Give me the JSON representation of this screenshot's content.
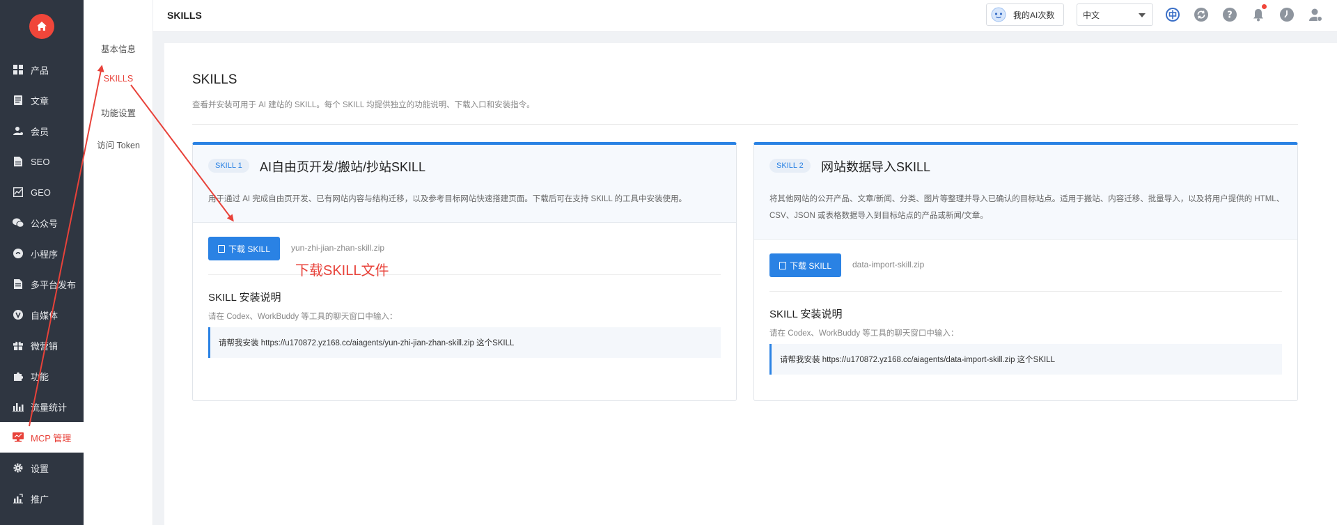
{
  "sidebar": {
    "items": [
      {
        "label": "产品",
        "icon": "grid-icon"
      },
      {
        "label": "文章",
        "icon": "document-icon"
      },
      {
        "label": "会员",
        "icon": "user-icon"
      },
      {
        "label": "SEO",
        "icon": "file-icon"
      },
      {
        "label": "GEO",
        "icon": "chart-icon"
      },
      {
        "label": "公众号",
        "icon": "wechat-icon"
      },
      {
        "label": "小程序",
        "icon": "miniprogram-icon"
      },
      {
        "label": "多平台发布",
        "icon": "publish-icon"
      },
      {
        "label": "自媒体",
        "icon": "v-icon"
      },
      {
        "label": "微营销",
        "icon": "gift-icon"
      },
      {
        "label": "功能",
        "icon": "puzzle-icon"
      },
      {
        "label": "流量统计",
        "icon": "bar-chart-icon"
      },
      {
        "label": "MCP 管理",
        "icon": "monitor-icon",
        "active": true
      },
      {
        "label": "设置",
        "icon": "gear-icon"
      },
      {
        "label": "推广",
        "icon": "promote-icon"
      }
    ]
  },
  "subnav": {
    "items": [
      {
        "label": "基本信息"
      },
      {
        "label": "SKILLS",
        "active": true
      },
      {
        "label": "功能设置"
      },
      {
        "label": "访问 Token"
      }
    ]
  },
  "header": {
    "title": "SKILLS",
    "ai_count_label": "我的AI次数",
    "language": "中文"
  },
  "main": {
    "title": "SKILLS",
    "description": "查看并安装可用于 AI 建站的 SKILL。每个 SKILL 均提供独立的功能说明、下载入口和安装指令。"
  },
  "cards": [
    {
      "badge": "SKILL 1",
      "title": "AI自由页开发/搬站/抄站SKILL",
      "description": "用于通过 AI 完成自由页开发、已有网站内容与结构迁移，以及参考目标网站快速搭建页面。下载后可在支持 SKILL 的工具中安装使用。",
      "download_label": "下载 SKILL",
      "filename": "yun-zhi-jian-zhan-skill.zip",
      "install_title": "SKILL 安装说明",
      "install_desc": "请在 Codex、WorkBuddy 等工具的聊天窗口中输入：",
      "command": "请帮我安装 https://u170872.yz168.cc/aiagents/yun-zhi-jian-zhan-skill.zip 这个SKILL"
    },
    {
      "badge": "SKILL 2",
      "title": "网站数据导入SKILL",
      "description": "将其他网站的公开产品、文章/新闻、分类、图片等整理并导入已确认的目标站点。适用于搬站、内容迁移、批量导入，以及将用户提供的 HTML、CSV、JSON 或表格数据导入到目标站点的产品或新闻/文章。",
      "download_label": "下载 SKILL",
      "filename": "data-import-skill.zip",
      "install_title": "SKILL 安装说明",
      "install_desc": "请在 Codex、WorkBuddy 等工具的聊天窗口中输入：",
      "command": "请帮我安装 https://u170872.yz168.cc/aiagents/data-import-skill.zip 这个SKILL"
    }
  ],
  "annotation": {
    "text": "下载SKILL文件"
  },
  "colors": {
    "sidebar_bg": "#2f3641",
    "accent": "#2a82e4",
    "active_red": "#e8423a"
  }
}
